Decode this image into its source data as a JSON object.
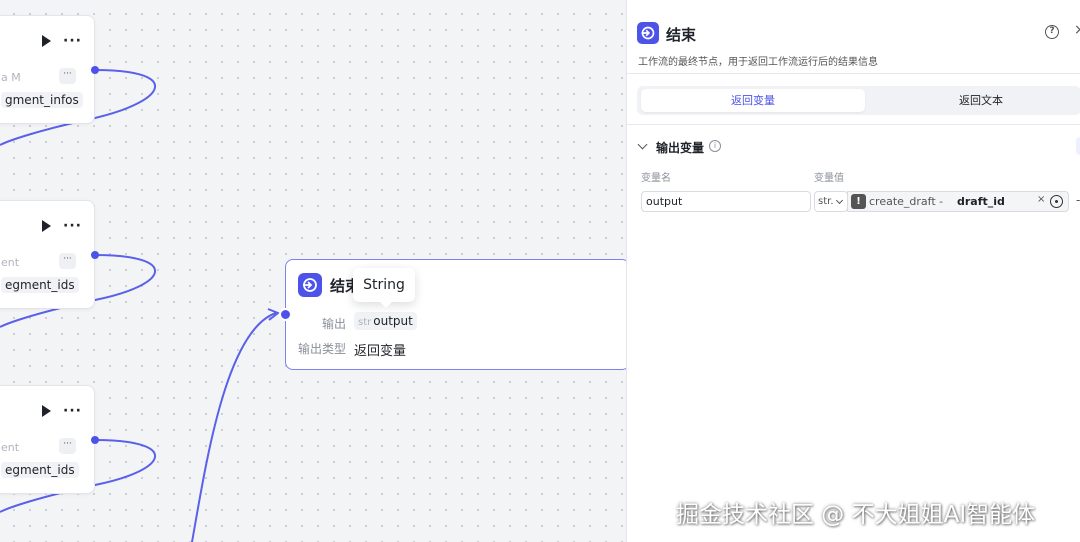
{
  "canvas": {
    "nodes": [
      {
        "faded_text": "a   M",
        "output_tag": "gment_infos"
      },
      {
        "faded_text": "ent",
        "output_tag": "egment_ids"
      },
      {
        "faded_text": "ent",
        "output_tag": "egment_ids"
      }
    ],
    "end_node": {
      "title": "结束",
      "output_label": "输出",
      "output_type_abbr": "str",
      "output_var": "output",
      "output_type_label": "输出类型",
      "output_type_value": "返回变量"
    },
    "tooltip": "String"
  },
  "panel": {
    "title": "结束",
    "help_symbol": "?",
    "close_symbol": "×",
    "description": "工作流的最终节点，用于返回工作流运行后的结果信息",
    "tabs": [
      {
        "label": "返回变量",
        "active": true
      },
      {
        "label": "返回文本",
        "active": false
      }
    ],
    "section_title": "输出变量",
    "info_symbol": "i",
    "col_name": "变量名",
    "col_value": "变量值",
    "row": {
      "name": "output",
      "type_abbr": "str.",
      "warn_symbol": "!",
      "source": "create_draft - ",
      "variable": "draft_id",
      "clear_symbol": "×",
      "extra_symbol": "-"
    }
  },
  "watermark": "掘金技术社区 @ 不大姐姐AI智能体",
  "colors": {
    "accent": "#4d53e8",
    "node_border": "#7d82f0"
  }
}
